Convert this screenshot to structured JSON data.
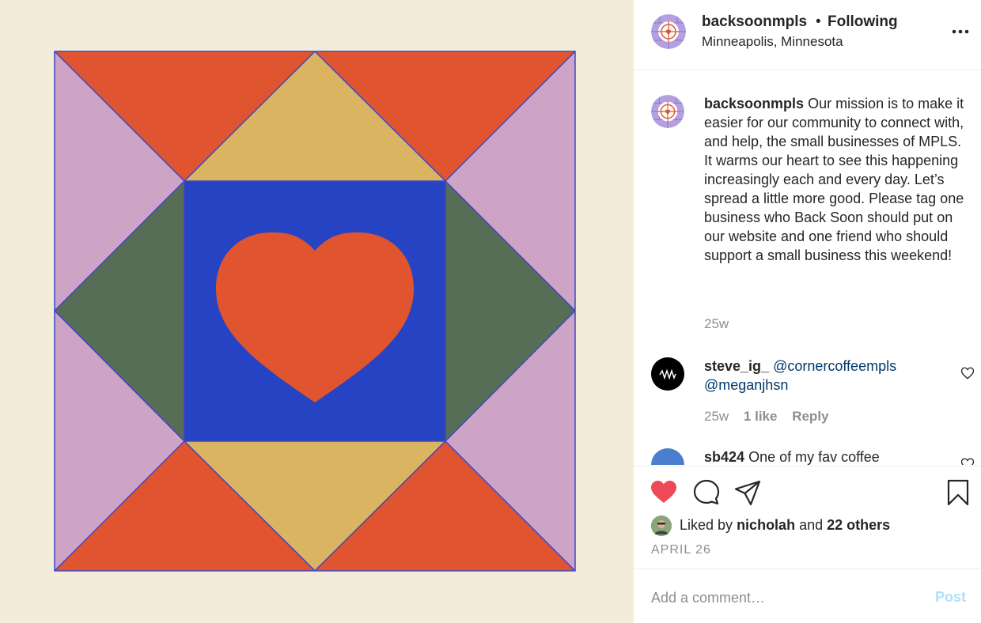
{
  "post": {
    "username": "backsoonmpls",
    "follow_separator": "•",
    "follow_status": "Following",
    "location": "Minneapolis, Minnesota",
    "more_icon": "more-horizontal-icon",
    "image_description_icon": "quilt-heart-artwork"
  },
  "caption": {
    "username": "backsoonmpls",
    "text": "Our mission is to make it easier for our community to connect with, and help, the small businesses of MPLS. It warms our heart to see this happening increasingly each and every day. Let’s spread a little more good. Please tag one business who Back Soon should put on our website and one friend who should support a small business this weekend!",
    "time": "25w"
  },
  "comments": [
    {
      "username": "steve_ig_",
      "mention1": "@cornercoffeempls",
      "mention2": "@meganjhsn",
      "time": "25w",
      "likes": "1 like",
      "reply": "Reply"
    },
    {
      "username": "sb424",
      "text": "One of my fav coffee"
    }
  ],
  "actions": {
    "liked_by_prefix": "Liked by",
    "liked_by_user": "nicholah",
    "liked_by_and": "and",
    "liked_by_others": "22 others",
    "date": "APRIL 26"
  },
  "add_comment": {
    "placeholder": "Add a comment…",
    "post_label": "Post"
  },
  "colors": {
    "orange": "#e05530",
    "mustard": "#dbb462",
    "pink": "#cda3c6",
    "green": "#566e55",
    "blue": "#2643c4",
    "background": "#f4ecdb",
    "like_red": "#ed4956"
  }
}
